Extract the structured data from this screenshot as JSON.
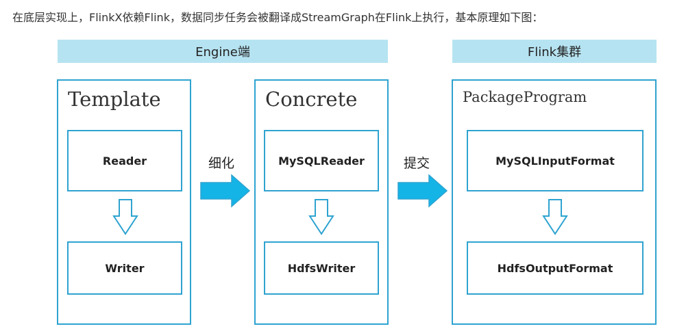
{
  "intro_text": "在底层实现上，FlinkX依赖Flink，数据同步任务会被翻译成StreamGraph在Flink上执行，基本原理如下图：",
  "bands": {
    "engine": "Engine端",
    "cluster": "Flink集群"
  },
  "panels": {
    "template": {
      "title": "Template",
      "top": "Reader",
      "bottom": "Writer"
    },
    "concrete": {
      "title": "Concrete",
      "top": "MySQLReader",
      "bottom": "HdfsWriter"
    },
    "package": {
      "title": "PackageProgram",
      "top": "MySQLInputFormat",
      "bottom": "HdfsOutputFormat"
    }
  },
  "arrows": {
    "refine": "细化",
    "submit": "提交"
  },
  "colors": {
    "accent": "#2ea3d0",
    "band": "#b6e3f1",
    "arrow_fill": "#14b4e6"
  }
}
